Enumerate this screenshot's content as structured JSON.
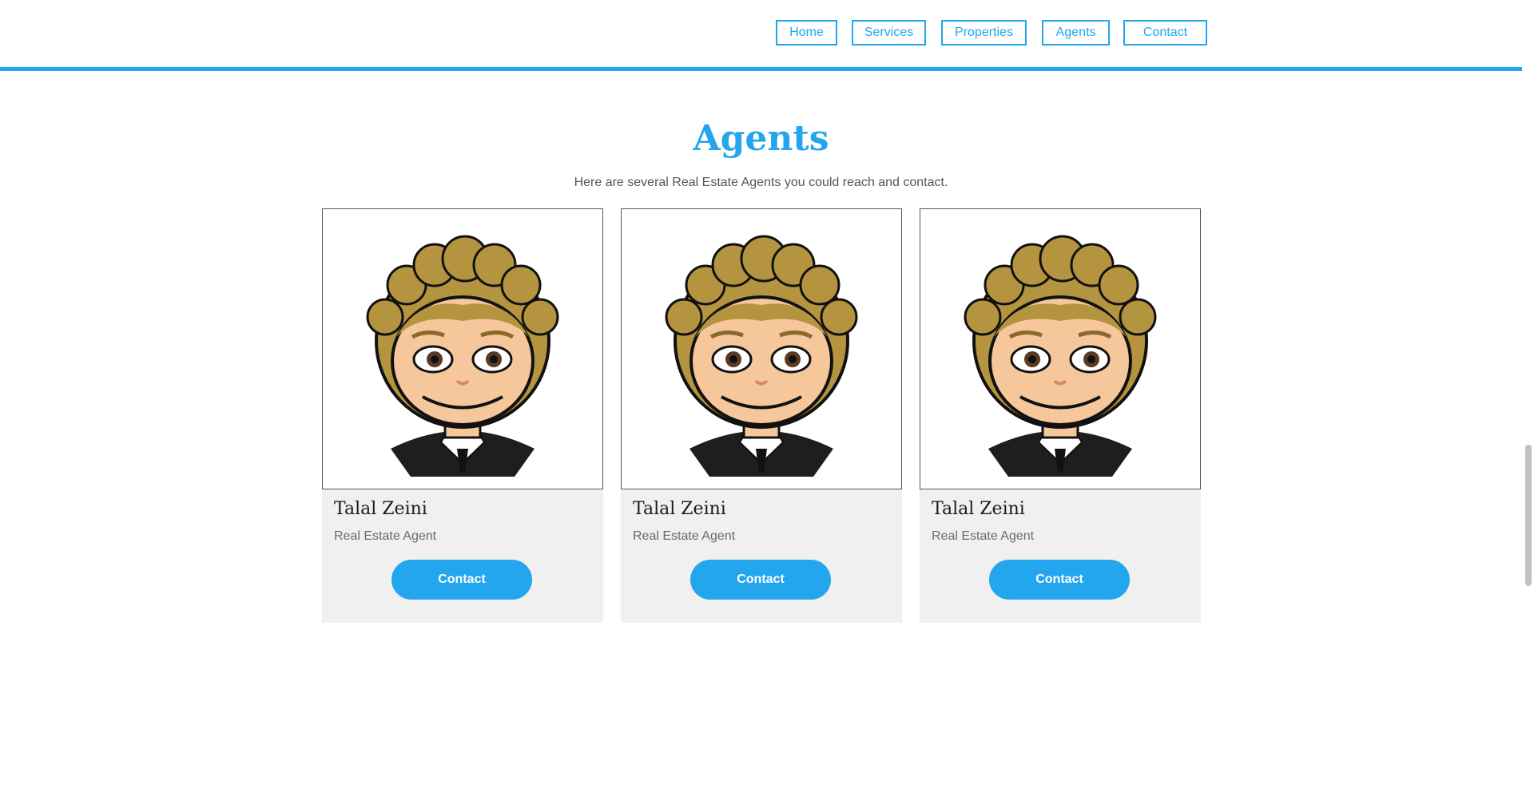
{
  "nav": {
    "items": [
      {
        "label": "Home"
      },
      {
        "label": "Services"
      },
      {
        "label": "Properties"
      },
      {
        "label": "Agents"
      },
      {
        "label": "Contact"
      }
    ]
  },
  "section": {
    "title": "Agents",
    "subtitle": "Here are several Real Estate Agents you could reach and contact."
  },
  "agents": [
    {
      "name": "Talal Zeini",
      "role": "Real Estate Agent",
      "button": "Contact"
    },
    {
      "name": "Talal Zeini",
      "role": "Real Estate Agent",
      "button": "Contact"
    },
    {
      "name": "Talal Zeini",
      "role": "Real Estate Agent",
      "button": "Contact"
    }
  ],
  "colors": {
    "accent": "#23a6ee",
    "card_bg": "#f0f0f0",
    "hair": "#b5943f",
    "skin": "#f5c79a"
  }
}
